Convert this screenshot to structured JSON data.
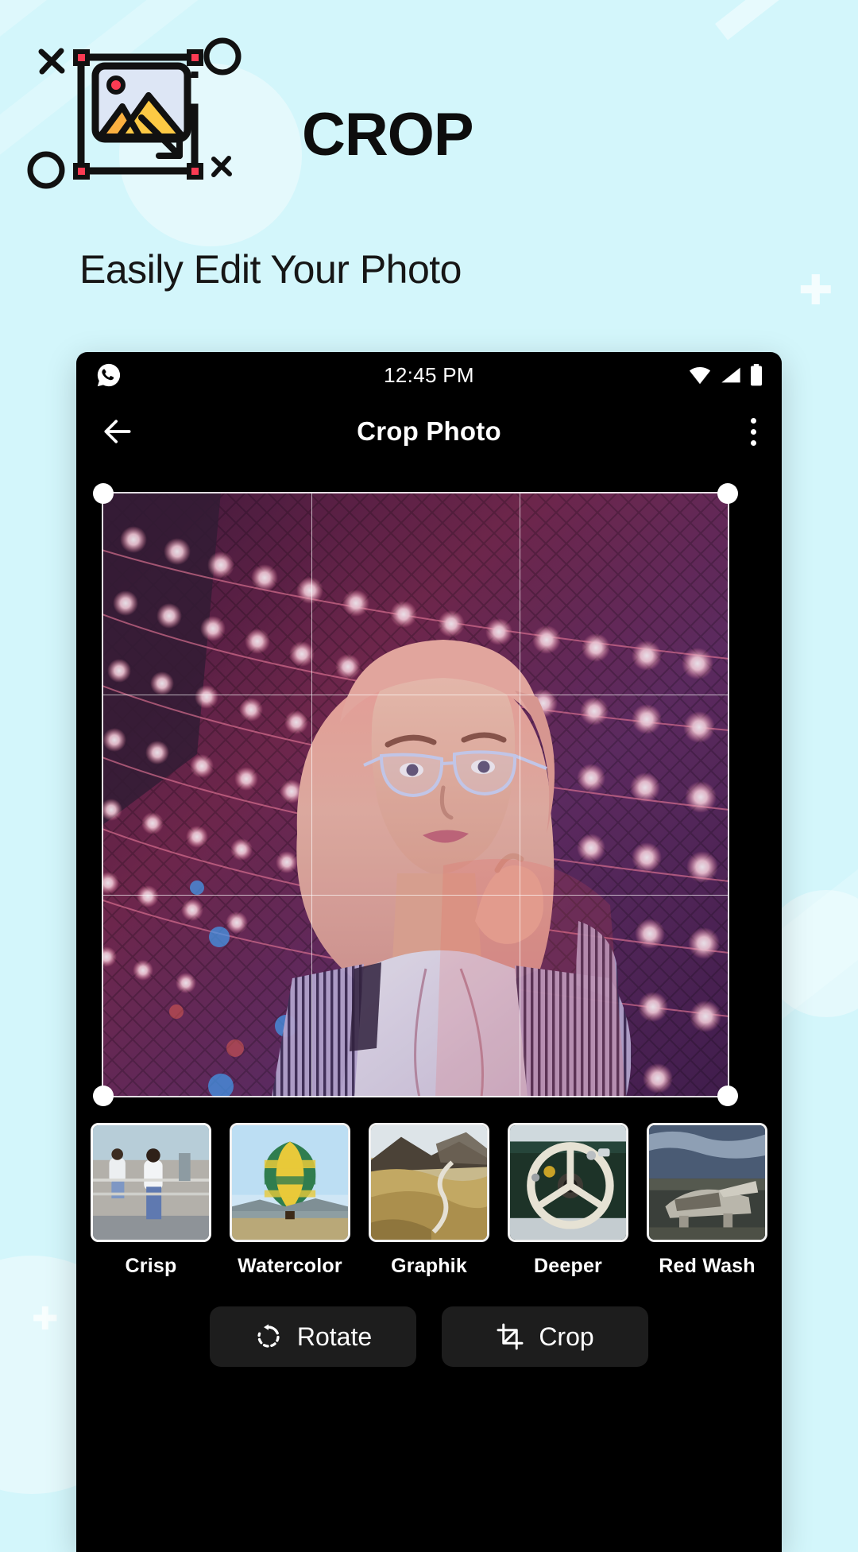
{
  "promo": {
    "title": "CROP",
    "subtitle": "Easily Edit Your Photo",
    "logo_icon": "crop-image-icon"
  },
  "phone": {
    "statusbar": {
      "notification_icon": "whatsapp-icon",
      "time": "12:45 PM",
      "wifi_icon": "wifi-icon",
      "signal_icon": "cellular-signal-icon",
      "battery_icon": "battery-full-icon"
    },
    "appbar": {
      "back_icon": "back-arrow-icon",
      "title": "Crop Photo",
      "overflow_icon": "kebab-menu-icon"
    },
    "editor": {
      "crop_grid": "rule-of-thirds-grid",
      "handles": [
        "top-left",
        "top-right",
        "bottom-left",
        "bottom-right"
      ],
      "photo_alt": "woman-with-glasses-string-lights"
    },
    "filters": [
      {
        "label": "Crisp",
        "thumb": "portrait-two-women-wall",
        "selected": true
      },
      {
        "label": "Watercolor",
        "thumb": "hot-air-balloon",
        "selected": false
      },
      {
        "label": "Graphik",
        "thumb": "golden-hills-road",
        "selected": false
      },
      {
        "label": "Deeper",
        "thumb": "vintage-steering-wheel",
        "selected": false
      },
      {
        "label": "Red Wash",
        "thumb": "plane-wreck-beach",
        "selected": false
      }
    ],
    "actions": [
      {
        "label": "Rotate",
        "icon": "rotate-ccw-icon"
      },
      {
        "label": "Crop",
        "icon": "crop-icon"
      }
    ]
  },
  "colors": {
    "background": "#d3f6fb",
    "phone_bg": "#000000",
    "accent_red": "#fb3b53",
    "accent_yellow": "#fdc944",
    "text_dark": "#0d0d0d",
    "button_bg": "#1d1d1d"
  }
}
